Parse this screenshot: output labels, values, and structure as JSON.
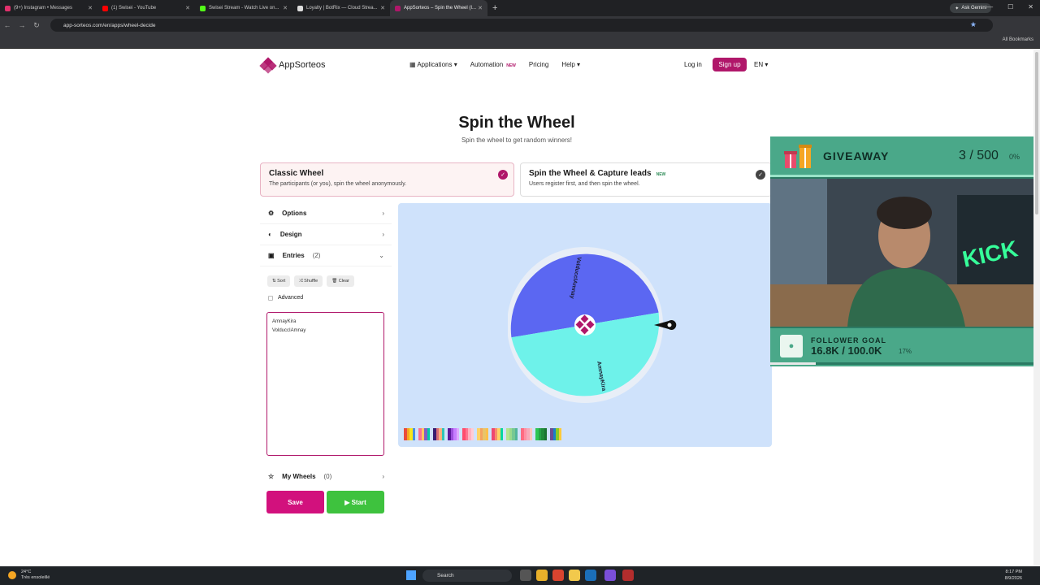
{
  "browser": {
    "tabs": [
      {
        "title": "(9+) Instagram • Messages",
        "color": "#e1306c"
      },
      {
        "title": "(1) Swisei - YouTube",
        "color": "#ff0000"
      },
      {
        "title": "Swisei Stream - Watch Live on...",
        "color": "#53fc18"
      },
      {
        "title": "Loyalty | BotRix — Cloud Strea...",
        "color": "#dddddd"
      },
      {
        "title": "AppSorteos – Spin the Wheel (I...",
        "color": "#b0176a"
      }
    ],
    "ask_gemini": "Ask Gemini",
    "url": "app-sorteos.com/en/apps/wheel-decide",
    "all_bookmarks": "All Bookmarks"
  },
  "header": {
    "logo": "AppSorteos",
    "nav": {
      "applications": "Applications",
      "automation": "Automation",
      "automation_badge": "NEW",
      "pricing": "Pricing",
      "help": "Help"
    },
    "login": "Log in",
    "signup": "Sign up",
    "lang": "EN"
  },
  "hero": {
    "title": "Spin the Wheel",
    "subtitle": "Spin the wheel to get random winners!"
  },
  "modes": {
    "classic": {
      "title": "Classic Wheel",
      "desc": "The participants (or you), spin the wheel anonymously."
    },
    "leads": {
      "title": "Spin the Wheel & Capture leads",
      "badge": "NEW",
      "desc": "Users register first, and then spin the wheel."
    }
  },
  "sidebar": {
    "options": "Options",
    "design": "Design",
    "entries": "Entries",
    "entries_count": "(2)",
    "sort": "Sort",
    "shuffle": "Shuffle",
    "clear": "Clear",
    "advanced": "Advanced",
    "entries_text": "AmnayKira\nVolduccIAmnay",
    "my_wheels": "My Wheels",
    "my_wheels_count": "(0)",
    "save": "Save",
    "start": "Start"
  },
  "wheel": {
    "segments": [
      {
        "label": "VolduccIAmnay",
        "color": "#5b67f2"
      },
      {
        "label": "AmnayKira",
        "color": "#6ef2ea"
      }
    ],
    "center_color": "#b0176a",
    "palettes": [
      [
        "#e94b3c",
        "#f5a623",
        "#f8e71c",
        "#4a90e2"
      ],
      [
        "#ff6f91",
        "#ffc75f",
        "#845ec2",
        "#00c9a7"
      ],
      [
        "#3a1c71",
        "#d76d77",
        "#ffaf7b",
        "#2ec4b6"
      ],
      [
        "#5a189a",
        "#9d4edd",
        "#c77dff",
        "#e0aaff"
      ],
      [
        "#ff4d6d",
        "#ff758f",
        "#ffb3c1",
        "#ffccd5"
      ],
      [
        "#ffd166",
        "#f4a261",
        "#e9c46a",
        "#fcbf49"
      ],
      [
        "#ef476f",
        "#f78c6b",
        "#ffd166",
        "#06d6a0"
      ],
      [
        "#b5e48c",
        "#99d98c",
        "#76c893",
        "#52b69a"
      ],
      [
        "#ff6b81",
        "#ff8fa3",
        "#f7a9b8",
        "#fec5bb"
      ],
      [
        "#2dc653",
        "#25a244",
        "#208b3a",
        "#1a7431"
      ],
      [
        "#6a4c93",
        "#1982c4",
        "#8ac926",
        "#ffca3a"
      ]
    ]
  },
  "overlay": {
    "giveaway_label": "GIVEAWAY",
    "giveaway_count": "3 / 500",
    "giveaway_pct": "0%",
    "follower_label": "FOLLOWER GOAL",
    "follower_value": "16.8K / 100.0K",
    "follower_pct": "17%",
    "follower_progress": 0.17,
    "cam_sign": "KICK"
  },
  "taskbar": {
    "weather_temp": "24°C",
    "weather_desc": "Très ensoleillé",
    "search": "Search",
    "time": "8:17 PM",
    "date": "8/9/2026"
  }
}
